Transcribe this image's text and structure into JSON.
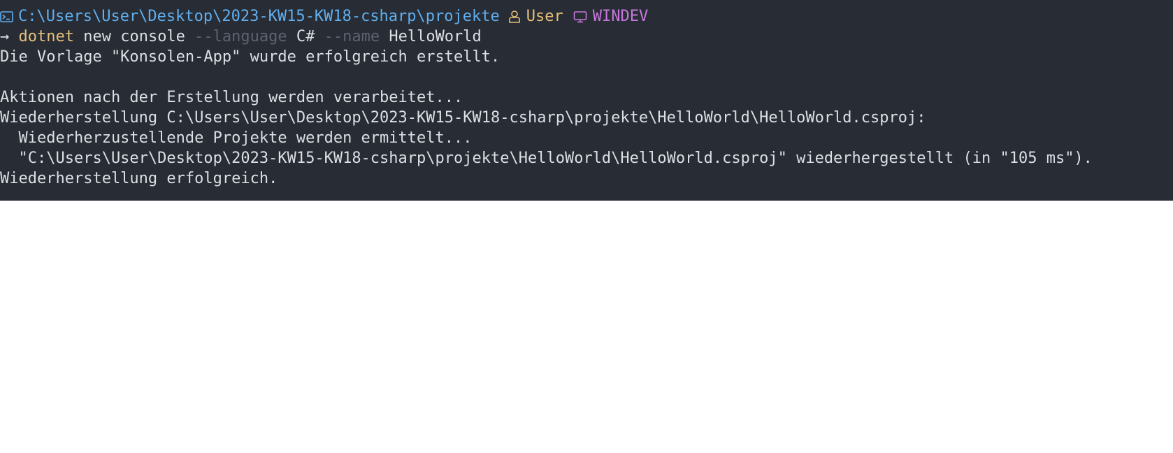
{
  "prompt": {
    "path": "C:\\Users\\User\\Desktop\\2023-KW15-KW18-csharp\\projekte",
    "user": "User",
    "host": "WINDEV",
    "colors": {
      "path": "#61afef",
      "user": "#e5c07b",
      "host": "#c678dd",
      "background": "#282c34"
    },
    "icons": {
      "shell": "terminal-icon",
      "user": "user-icon",
      "host": "monitor-icon"
    }
  },
  "command": {
    "arrow": "→",
    "program": "dotnet",
    "subcommand": " new console ",
    "flag_language": "--language",
    "language_value": " C# ",
    "flag_name": "--name",
    "name_value": " HelloWorld"
  },
  "output": [
    "Die Vorlage \"Konsolen-App\" wurde erfolgreich erstellt.",
    "",
    "Aktionen nach der Erstellung werden verarbeitet...",
    "Wiederherstellung C:\\Users\\User\\Desktop\\2023-KW15-KW18-csharp\\projekte\\HelloWorld\\HelloWorld.csproj:",
    "  Wiederherzustellende Projekte werden ermittelt...",
    "  \"C:\\Users\\User\\Desktop\\2023-KW15-KW18-csharp\\projekte\\HelloWorld\\HelloWorld.csproj\" wiederhergestellt (in \"105 ms\").",
    "Wiederherstellung erfolgreich."
  ]
}
